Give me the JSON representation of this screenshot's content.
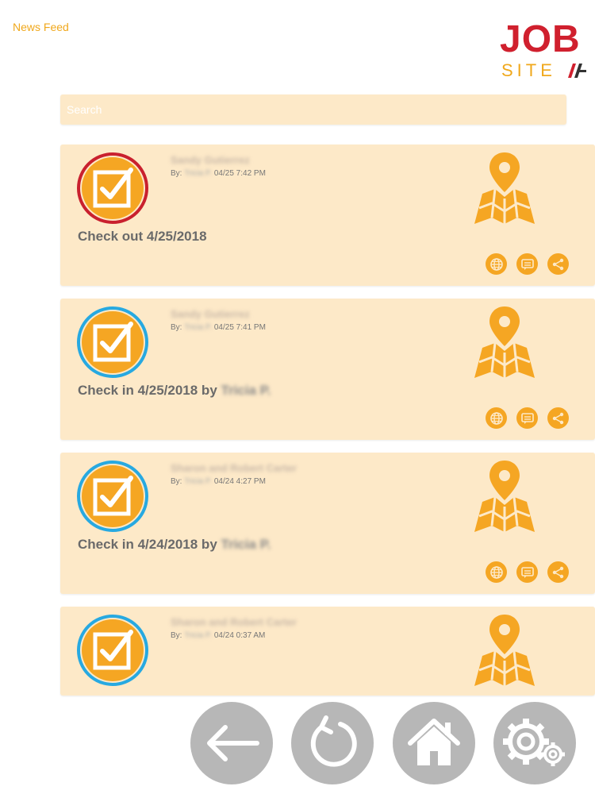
{
  "header": {
    "nav_title": "News Feed",
    "logo_top": "JOB",
    "logo_bottom": "SITE"
  },
  "search": {
    "placeholder": "Search"
  },
  "feed": {
    "items": [
      {
        "author": "Sandy Gutierrez",
        "by_label": "By:",
        "by_name": "Tricia P.",
        "timestamp": "04/25 7:42 PM",
        "title": "Check out 4/25/2018",
        "title_suffix": "",
        "status": "check-out"
      },
      {
        "author": "Sandy Gutierrez",
        "by_label": "By:",
        "by_name": "Tricia P.",
        "timestamp": "04/25 7:41 PM",
        "title": "Check in 4/25/2018 by",
        "title_suffix": "Tricia P.",
        "status": "check-in"
      },
      {
        "author": "Sharon and Robert Carter",
        "by_label": "By:",
        "by_name": "Tricia P.",
        "timestamp": "04/24 4:27 PM",
        "title": "Check in 4/24/2018 by",
        "title_suffix": "Tricia P.",
        "status": "check-in"
      },
      {
        "author": "Sharon and Robert Carter",
        "by_label": "By:",
        "by_name": "Tricia P.",
        "timestamp": "04/24 0:37 AM",
        "title": "",
        "title_suffix": "",
        "status": "check-in"
      }
    ]
  },
  "icons": {
    "check": "checkbox-check-icon",
    "map": "map-pin-icon",
    "globe": "globe-icon",
    "comment": "comment-icon",
    "share": "share-icon",
    "back": "back-arrow-icon",
    "refresh": "refresh-icon",
    "home": "home-icon",
    "settings": "gear-icon"
  },
  "colors": {
    "accent": "#f5a623",
    "card_bg": "#fde9c8",
    "check_out_ring": "#c9202e",
    "check_in_ring": "#27a9e1",
    "logo_red": "#d0202e",
    "nav_gray": "#b7b7b7"
  }
}
